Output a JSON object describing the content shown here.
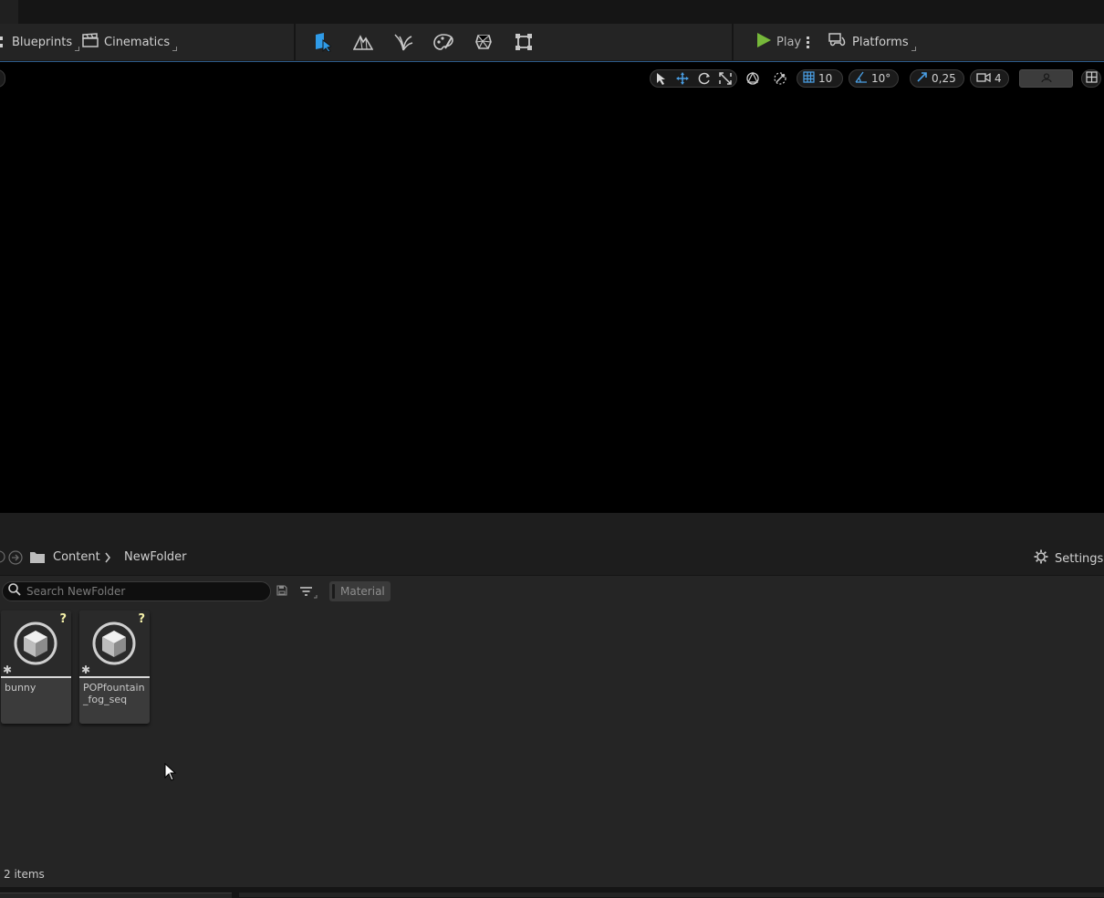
{
  "toolbar": {
    "blueprints_label": "Blueprints",
    "cinematics_label": "Cinematics",
    "play_label": "Play",
    "platforms_label": "Platforms",
    "colors": {
      "accent_blue": "#2f9be8",
      "play_green": "#76b83a"
    }
  },
  "viewport": {
    "grid_snap": "10",
    "rotation_snap": "10°",
    "scale_snap": "0,25",
    "camera_speed": "4"
  },
  "content_browser": {
    "breadcrumb": [
      "Content",
      "NewFolder"
    ],
    "settings_label": "Settings",
    "search_placeholder": "Search NewFolder",
    "filter_chip": "Material",
    "assets": [
      {
        "name": "bunny",
        "badge": "?"
      },
      {
        "name": "POPfountain_fog_seq",
        "badge": "?"
      }
    ],
    "status": "2 items"
  }
}
